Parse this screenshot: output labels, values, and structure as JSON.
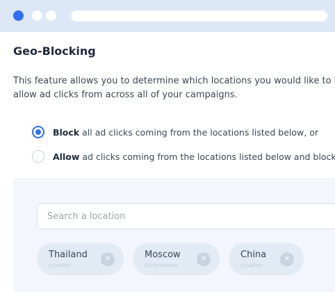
{
  "window": {
    "colors": {
      "accent": "#2f6ef5",
      "titlebar": "#dce8f6",
      "panel": "#f3f7fd",
      "chip": "#e2eaf4"
    }
  },
  "header": {
    "title": "Geo-Blocking"
  },
  "description": {
    "text": "This feature allows you to determine which locations you would like to block or allow ad clicks from across all of your campaigns."
  },
  "options": [
    {
      "bold": "Block",
      "rest": "all ad clicks coming from the locations listed below, or",
      "selected": true
    },
    {
      "bold": "Allow",
      "rest": "ad clicks coming from the locations listed below and block all others",
      "selected": false
    }
  ],
  "search": {
    "placeholder": "Search a location",
    "value": ""
  },
  "locations": [
    {
      "name": "Thailand",
      "type": "COUNTRY",
      "remove_icon": "close-icon",
      "remove_glyph": "✕"
    },
    {
      "name": "Moscow",
      "type": "STATE/REGION",
      "remove_icon": "close-icon",
      "remove_glyph": "✕"
    },
    {
      "name": "China",
      "type": "COUNTRY",
      "remove_icon": "close-icon",
      "remove_glyph": "✕"
    }
  ]
}
